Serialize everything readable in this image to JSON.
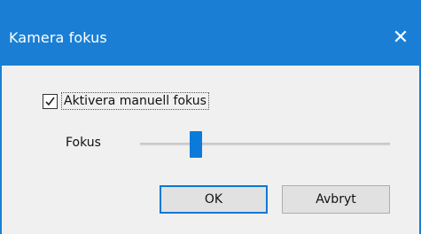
{
  "window": {
    "title": "Kamera fokus",
    "close_glyph": "✕"
  },
  "manual_focus": {
    "label": "Aktivera manuell fokus",
    "checked": true
  },
  "focus": {
    "label": "Fokus",
    "slider_fraction": 0.21
  },
  "buttons": {
    "ok_label": "OK",
    "cancel_label": "Avbryt"
  },
  "colors": {
    "titlebar": "#1a7fd4",
    "accent": "#0b7bd9"
  },
  "icons": {
    "close": "close-icon",
    "check": "checkmark-icon"
  }
}
